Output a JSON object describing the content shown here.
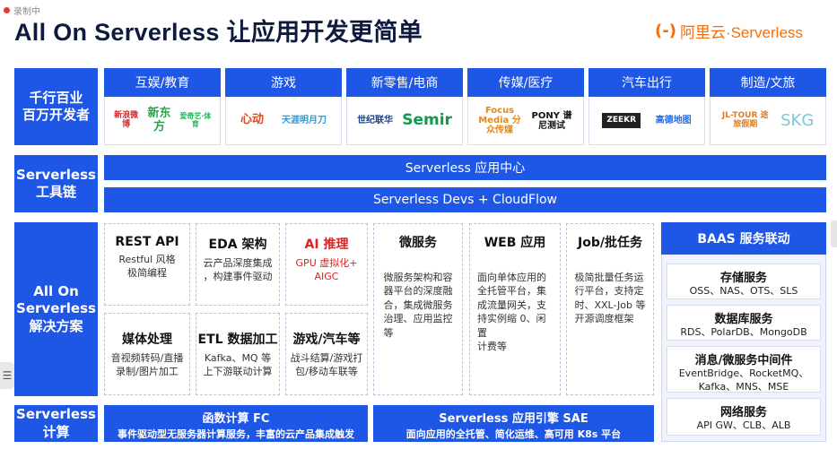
{
  "recorder": "录制中",
  "title": "All On Serverless 让应用开发更简单",
  "brand": {
    "mark": "(-)",
    "name": "阿里云·Serverless",
    "color": "#ff6a00"
  },
  "rows": {
    "industry": "千行百业\n百万开发者",
    "tools": "Serverless\n工具链",
    "solutions": "All On\nServerless\n解决方案",
    "compute": "Serverless\n计算"
  },
  "industries": [
    {
      "name": "互娱/教育",
      "logos": [
        "新浪微博",
        "新东方",
        "爱奇艺·体育"
      ]
    },
    {
      "name": "游戏",
      "logos": [
        "心动",
        "天涯明月刀"
      ]
    },
    {
      "name": "新零售/电商",
      "logos": [
        "世纪联华",
        "Semir"
      ]
    },
    {
      "name": "传媒/医疗",
      "logos": [
        "Focus Media 分众传媒",
        "PONY 谱尼测试"
      ]
    },
    {
      "name": "汽车出行",
      "logos": [
        "ZEEKR",
        "高德地图"
      ]
    },
    {
      "name": "制造/文旅",
      "logos": [
        "JL-TOUR 途旅假期",
        "SKG"
      ]
    }
  ],
  "toolchain": [
    "Serverless 应用中心",
    "Serverless Devs + CloudFlow"
  ],
  "cards": [
    {
      "title": "REST API",
      "desc": "Restful 风格\n极简编程"
    },
    {
      "title": "EDA 架构",
      "desc": "云产品深度集成\n，构建事件驱动"
    },
    {
      "title": "AI 推理",
      "desc": "GPU 虚拟化+\nAIGC"
    },
    {
      "title": "媒体处理",
      "desc": "音视频转码/直播\n录制/图片加工"
    },
    {
      "title": "ETL 数据加工",
      "desc": "Kafka、MQ 等\n上下游联动计算"
    },
    {
      "title": "游戏/汽车等",
      "desc": "战斗结算/游戏打\n包/移动车联等"
    }
  ],
  "tall_cards": [
    {
      "title": "微服务",
      "desc": "微服务架构和容\n器平台的深度融\n合，集成微服务\n治理、应用监控\n等"
    },
    {
      "title": "WEB 应用",
      "desc": "面向单体应用的\n全托管平台，集\n成流量网关，支\n持实例缩 0、闲置\n计费等"
    },
    {
      "title": "Job/批任务",
      "desc": "极简批量任务运\n行平台，支持定\n时、XXL-Job 等\n开源调度框架"
    }
  ],
  "baas": {
    "title": "BAAS 服务联动",
    "items": [
      {
        "title": "存储服务",
        "desc": "OSS、NAS、OTS、SLS"
      },
      {
        "title": "数据库服务",
        "desc": "RDS、PolarDB、MongoDB"
      },
      {
        "title": "消息/微服务中间件",
        "desc": "EventBridge、RocketMQ、\nKafka、MNS、MSE"
      },
      {
        "title": "网络服务",
        "desc": "API GW、CLB、ALB"
      }
    ]
  },
  "compute": [
    {
      "title": "函数计算 FC",
      "desc": "事件驱动型无服务器计算服务，丰富的云产品集成触发"
    },
    {
      "title": "Serverless 应用引擎 SAE",
      "desc": "面向应用的全托管、简化运维、高可用 K8s 平台"
    }
  ],
  "colors": {
    "primary": "#1e56e6",
    "accent": "#ff6a00",
    "highlight": "#e02020"
  },
  "edge_icon": "list-icon"
}
